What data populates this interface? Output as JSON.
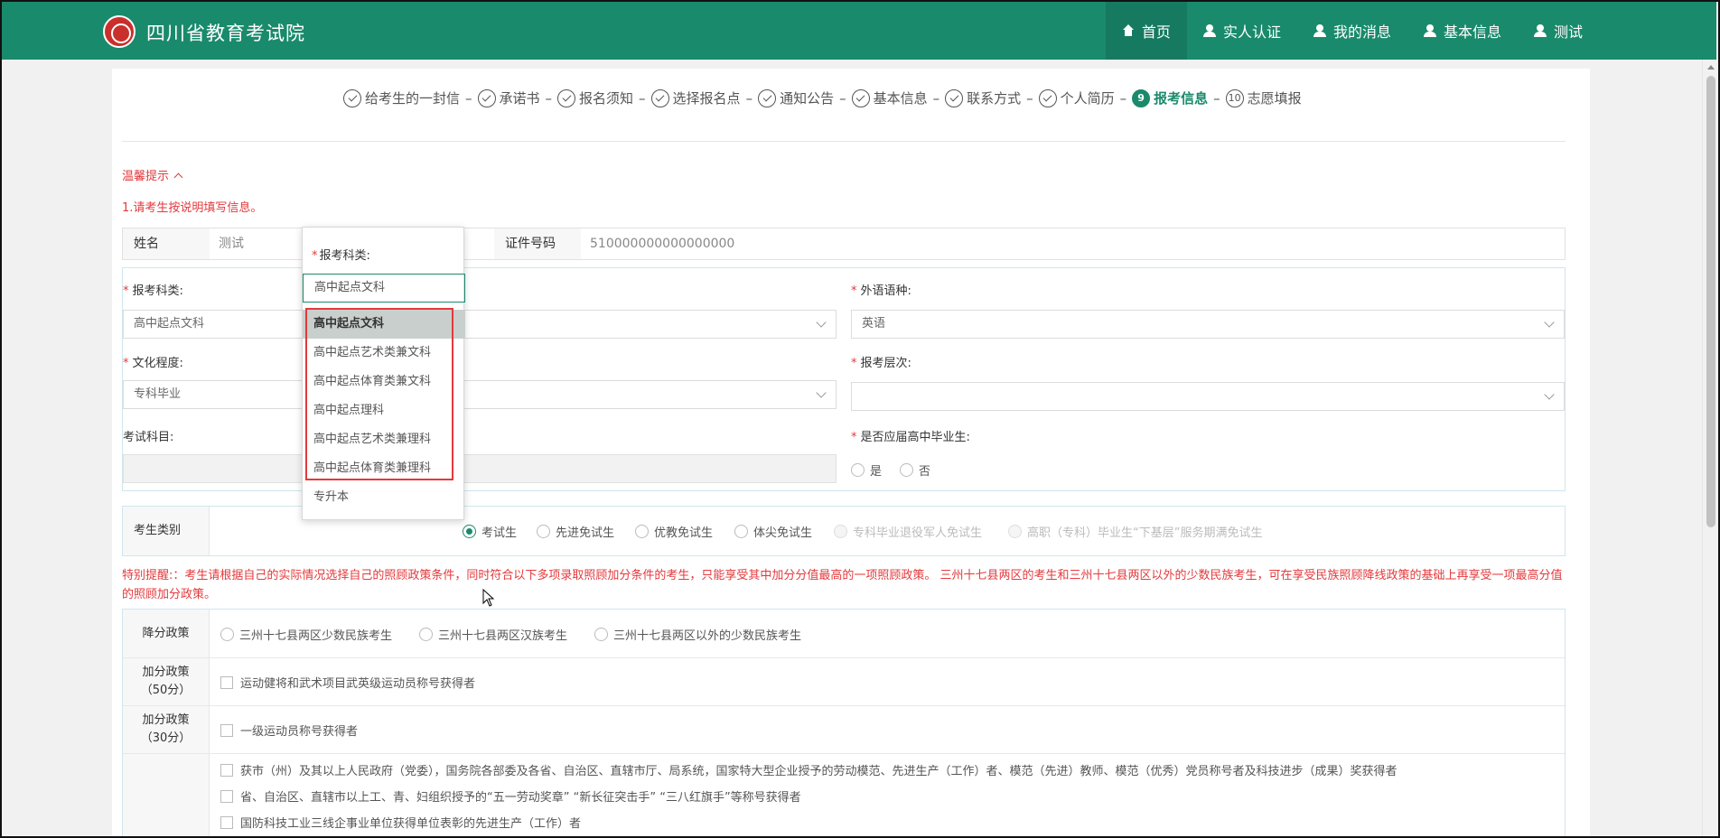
{
  "header": {
    "brand": "四川省教育考试院",
    "nav": [
      {
        "label": "首页",
        "icon": "home-icon",
        "active": true
      },
      {
        "label": "实人认证",
        "icon": "user-icon"
      },
      {
        "label": "我的消息",
        "icon": "user-icon"
      },
      {
        "label": "基本信息",
        "icon": "user-icon"
      },
      {
        "label": "测试",
        "icon": "user-icon"
      }
    ]
  },
  "steps": [
    {
      "label": "给考生的一封信",
      "state": "done"
    },
    {
      "label": "承诺书",
      "state": "done"
    },
    {
      "label": "报名须知",
      "state": "done"
    },
    {
      "label": "选择报名点",
      "state": "done"
    },
    {
      "label": "通知公告",
      "state": "done"
    },
    {
      "label": "基本信息",
      "state": "done"
    },
    {
      "label": "联系方式",
      "state": "done"
    },
    {
      "label": "个人简历",
      "state": "done"
    },
    {
      "label": "报考信息",
      "state": "current",
      "num": "9"
    },
    {
      "label": "志愿填报",
      "state": "todo",
      "num": "10"
    }
  ],
  "tips": {
    "title": "温馨提示",
    "line1": "1.请考生按说明填写信息。"
  },
  "info": {
    "name_label": "姓名",
    "name_value": "测试",
    "id_label": "证件号码",
    "id_value": "510000000000000000"
  },
  "form": {
    "subject_label": "报考科类:",
    "subject_value": "高中起点文科",
    "language_label": "外语语种:",
    "language_value": "英语",
    "education_label": "文化程度:",
    "education_value": "专科毕业",
    "level_label": "报考层次:",
    "level_value": "",
    "exam_subjects_label": "考试科目:",
    "graduate_label": "是否应届高中毕业生:",
    "graduate_yes": "是",
    "graduate_no": "否"
  },
  "category": {
    "label": "考生类别",
    "options": [
      {
        "label": "考试生",
        "checked": true,
        "disabled": false
      },
      {
        "label": "先进免试生",
        "checked": false,
        "disabled": false
      },
      {
        "label": "优教免试生",
        "checked": false,
        "disabled": false
      },
      {
        "label": "体尖免试生",
        "checked": false,
        "disabled": false
      },
      {
        "label": "专科毕业退役军人免试生",
        "checked": false,
        "disabled": true
      },
      {
        "label": "高职（专科）毕业生“下基层”服务期满免试生",
        "checked": false,
        "disabled": true
      }
    ]
  },
  "notice": "特别提醒:：考生请根据自己的实际情况选择自己的照顾政策条件，同时符合以下多项录取照顾加分条件的考生，只能享受其中加分分值最高的一项照顾政策。 三州十七县两区的考生和三州十七县两区以外的少数民族考生，可在享受民族照顾降线政策的基础上再享受一项最高分值的照顾加分政策。",
  "policy": {
    "reduce_label": "降分政策",
    "reduce_options": [
      "三州十七县两区少数民族考生",
      "三州十七县两区汉族考生",
      "三州十七县两区以外的少数民族考生"
    ],
    "bonus50_label_1": "加分政策",
    "bonus50_label_2": "（50分）",
    "bonus50_item": "运动健将和武术项目武英级运动员称号获得者",
    "bonus30_label_1": "加分政策",
    "bonus30_label_2": "（30分）",
    "bonus30_item": "一级运动员称号获得者",
    "other_items": [
      "获市（州）及其以上人民政府（党委），国务院各部委及各省、自治区、直辖市厅、局系统，国家特大型企业授予的劳动模范、先进生产（工作）者、模范（先进）教师、模范（优秀）党员称号者及科技进步（成果）奖获得者",
      "省、自治区、直辖市以上工、青、妇组织授予的“五一劳动奖章” “新长征突击手” “三八红旗手”等称号获得者",
      "国防科技工业三线企事业单位获得单位表彰的先进生产（工作）者"
    ]
  },
  "dropdown": {
    "label": "报考科类:",
    "input_value": "高中起点文科",
    "options": [
      {
        "label": "高中起点文科",
        "selected": true
      },
      {
        "label": "高中起点艺术类兼文科",
        "selected": false
      },
      {
        "label": "高中起点体育类兼文科",
        "selected": false
      },
      {
        "label": "高中起点理科",
        "selected": false
      },
      {
        "label": "高中起点艺术类兼理科",
        "selected": false
      },
      {
        "label": "高中起点体育类兼理科",
        "selected": false
      },
      {
        "label": "专升本",
        "selected": false
      }
    ]
  }
}
